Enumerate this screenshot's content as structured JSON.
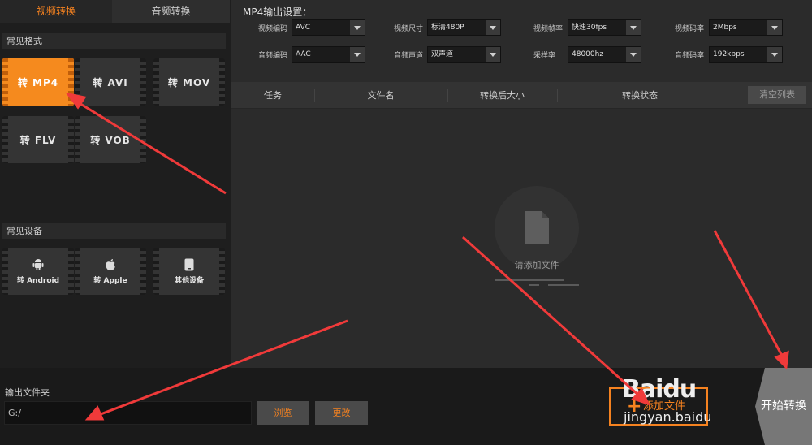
{
  "tabs": {
    "video": "视频转换",
    "audio": "音频转换"
  },
  "sections": {
    "formats": "常见格式",
    "devices": "常见设备"
  },
  "formats": [
    {
      "label": "转 MP4",
      "active": true
    },
    {
      "label": "转 AVI"
    },
    {
      "label": "转 MOV"
    },
    {
      "label": "转 FLV"
    },
    {
      "label": "转 VOB"
    }
  ],
  "devices": [
    {
      "label": "转 Android",
      "icon": "android-icon"
    },
    {
      "label": "转 Apple",
      "icon": "apple-icon"
    },
    {
      "label": "其他设备",
      "icon": "device-icon"
    }
  ],
  "settings": {
    "title": "MP4输出设置：",
    "video_codec": {
      "label": "视频编码",
      "value": "AVC"
    },
    "video_size": {
      "label": "视频尺寸",
      "value": "标清480P"
    },
    "video_fps": {
      "label": "视频帧率",
      "value": "快速30fps"
    },
    "video_bitrate": {
      "label": "视频码率",
      "value": "2Mbps"
    },
    "audio_codec": {
      "label": "音频编码",
      "value": "AAC"
    },
    "audio_channel": {
      "label": "音频声道",
      "value": "双声道"
    },
    "sample_rate": {
      "label": "采样率",
      "value": "48000hz"
    },
    "audio_bitrate": {
      "label": "音频码率",
      "value": "192kbps"
    }
  },
  "table": {
    "headers": [
      "任务",
      "文件名",
      "转换后大小",
      "转换状态"
    ],
    "clear_label": "清空列表",
    "empty_text": "请添加文件"
  },
  "output": {
    "label": "输出文件夹",
    "path": "G:/",
    "browse": "浏览",
    "change": "更改"
  },
  "add_file": "添加文件",
  "start": "开始转换",
  "watermark": {
    "line1": "Baidu",
    "line2": "jingyan.baidu"
  },
  "colors": {
    "accent": "#f58220",
    "annotation": "#f03a3a"
  }
}
